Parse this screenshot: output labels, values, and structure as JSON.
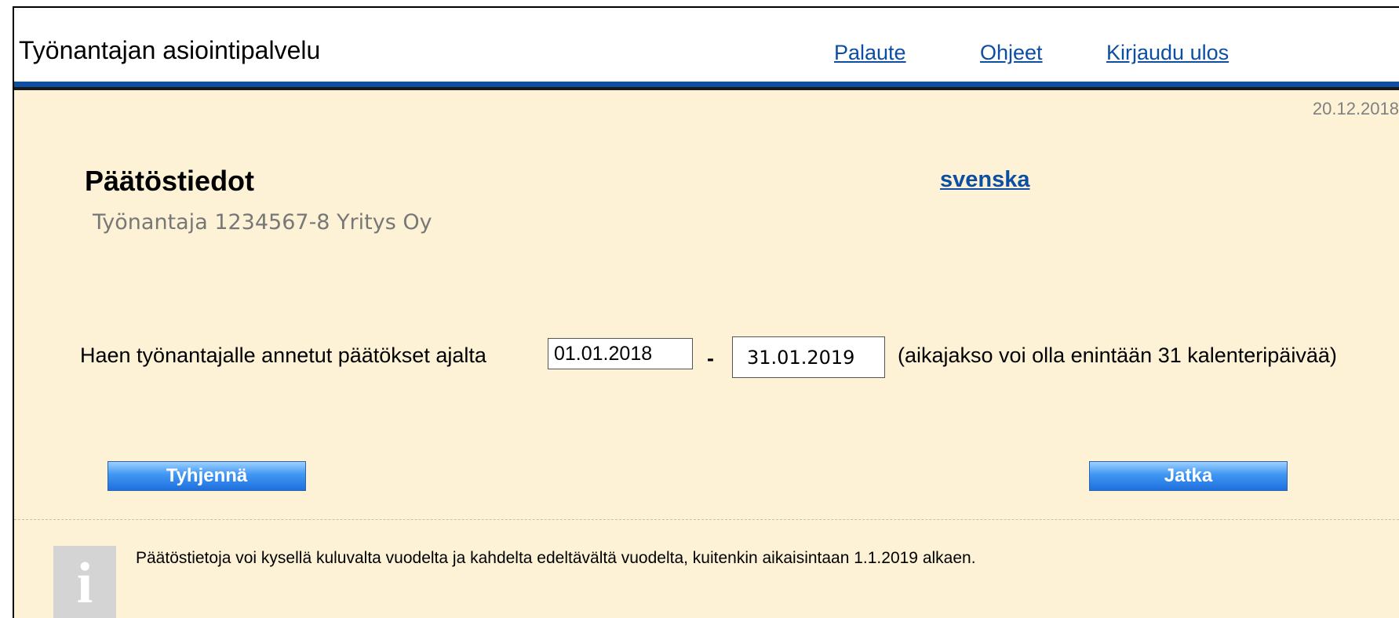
{
  "header": {
    "app_title": "Työnantajan asiointipalvelu",
    "links": {
      "feedback": "Palaute",
      "help": "Ohjeet",
      "logout": "Kirjaudu ulos"
    }
  },
  "date": "20.12.2018",
  "page": {
    "title": "Päätöstiedot",
    "employer": "Työnantaja 1234567-8 Yritys Oy",
    "language_link": "svenska"
  },
  "query": {
    "label": "Haen työnantajalle annetut päätökset ajalta",
    "start_date": "01.01.2018",
    "separator": "-",
    "end_date": "31.01.2019",
    "hint": "(aikajakso voi olla enintään 31 kalenteripäivää)"
  },
  "buttons": {
    "clear": "Tyhjennä",
    "continue": "Jatka"
  },
  "info": {
    "icon_glyph": "i",
    "text": "Päätöstietoja voi kysellä kuluvalta vuodelta ja kahdelta edeltävältä vuodelta, kuitenkin aikaisintaan 1.1.2019 alkaen."
  },
  "colors": {
    "page_background": "#fdf2d6",
    "link": "#0b4ea2",
    "header_rule": "#0e4fa1",
    "button": "#1f6fde"
  }
}
